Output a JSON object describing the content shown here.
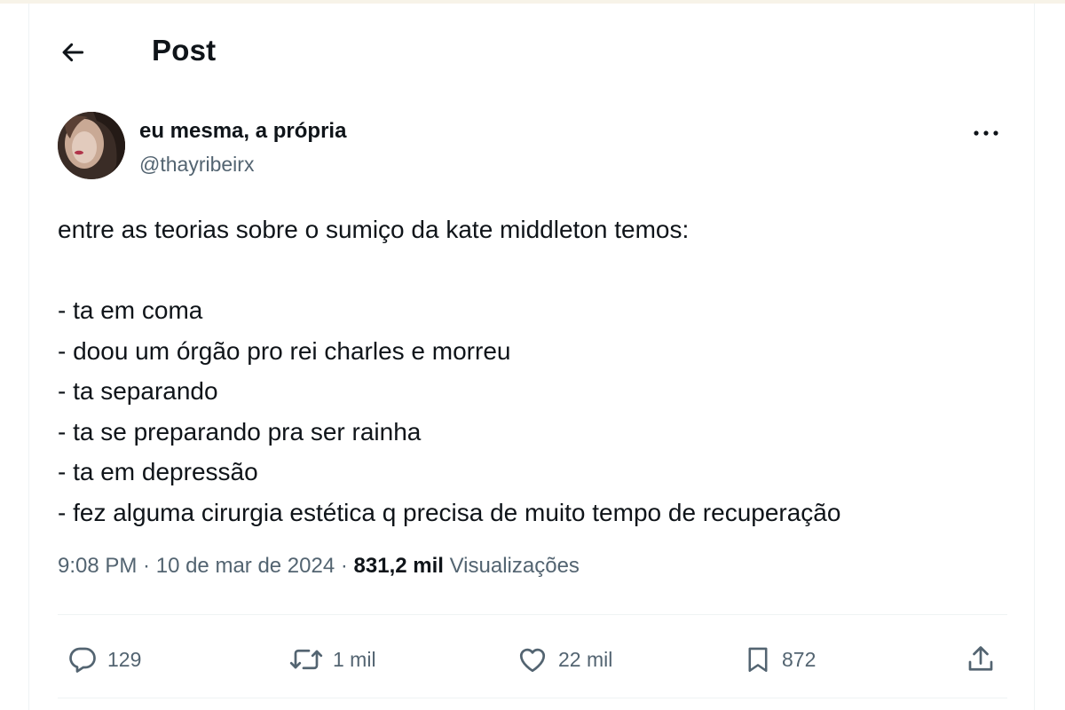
{
  "header": {
    "title": "Post"
  },
  "author": {
    "name": "eu mesma, a própria",
    "handle": "@thayribeirx"
  },
  "tweet": {
    "lines": [
      "entre as teorias sobre o sumiço da kate middleton temos:",
      "",
      "- ta em coma",
      "- doou um órgão pro rei charles e morreu",
      "- ta separando",
      "- ta se preparando pra ser rainha",
      "- ta em depressão",
      "- fez alguma cirurgia estética q precisa de muito tempo de recuperação"
    ]
  },
  "meta": {
    "time": "9:08 PM",
    "separator1": " · ",
    "date": "10 de mar de 2024",
    "separator2": " · ",
    "views_count": "831,2 mil",
    "views_label": " Visualizações"
  },
  "actions": {
    "replies": "129",
    "reposts": "1 mil",
    "likes": "22 mil",
    "bookmarks": "872"
  },
  "icons": {
    "back": "arrow-left-icon",
    "more": "more-horizontal-icon",
    "reply": "reply-icon",
    "repost": "repost-icon",
    "like": "heart-icon",
    "bookmark": "bookmark-icon",
    "share": "share-icon"
  },
  "colors": {
    "text": "#0f1419",
    "secondary": "#536471",
    "border": "#eff3f4"
  }
}
